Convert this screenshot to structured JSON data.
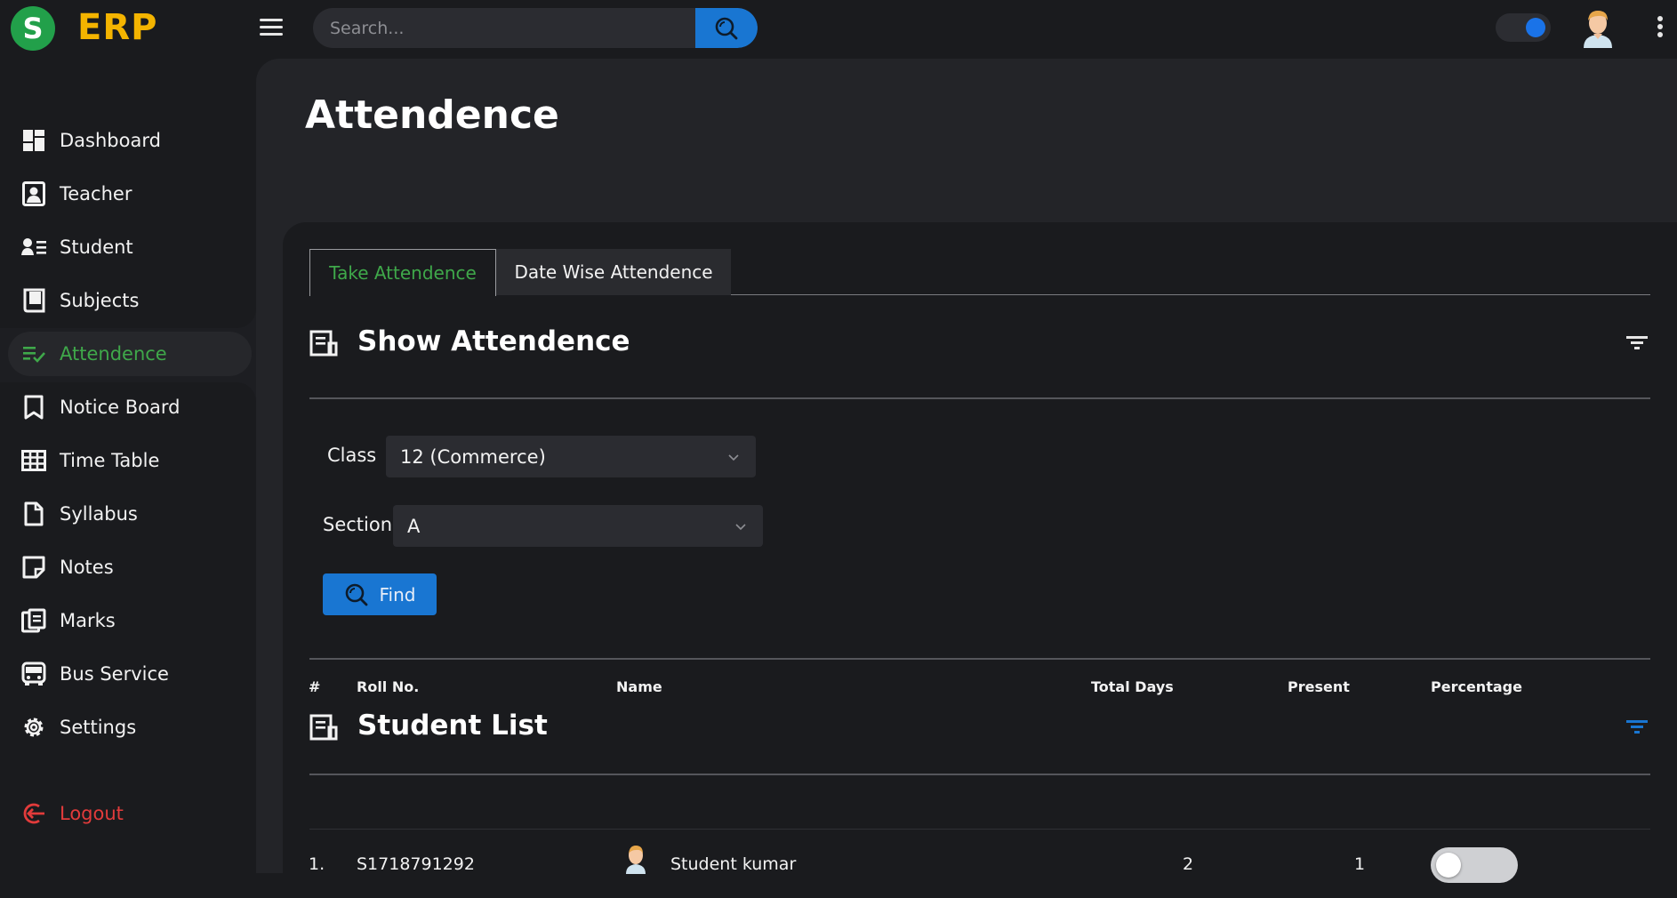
{
  "app": {
    "logo_letter": "S",
    "logo_text": "ERP"
  },
  "search": {
    "placeholder": "Search..."
  },
  "sidebar": {
    "items": [
      {
        "label": "Dashboard",
        "icon": "dashboard-icon"
      },
      {
        "label": "Teacher",
        "icon": "teacher-icon"
      },
      {
        "label": "Student",
        "icon": "student-icon"
      },
      {
        "label": "Subjects",
        "icon": "book-icon"
      },
      {
        "label": "Attendence",
        "icon": "checklist-icon",
        "active": true
      },
      {
        "label": "Notice Board",
        "icon": "bookmark-icon"
      },
      {
        "label": "Time Table",
        "icon": "table-grid-icon"
      },
      {
        "label": "Syllabus",
        "icon": "document-icon"
      },
      {
        "label": "Notes",
        "icon": "note-icon"
      },
      {
        "label": "Marks",
        "icon": "clipboard-icon"
      },
      {
        "label": "Bus Service",
        "icon": "bus-icon"
      },
      {
        "label": "Settings",
        "icon": "gear-icon"
      }
    ],
    "logout": "Logout"
  },
  "page": {
    "title": "Attendence"
  },
  "tabs": {
    "take": "Take Attendence",
    "date_wise": "Date Wise Attendence"
  },
  "show_section": {
    "title": "Show Attendence"
  },
  "form": {
    "class_label": "Class",
    "class_value": "12 (Commerce)",
    "section_label": "Section",
    "section_value": "A",
    "find_label": "Find"
  },
  "student_section": {
    "title": "Student List"
  },
  "table": {
    "headers": [
      "#",
      "Roll No.",
      "Name",
      "Total Days",
      "Present",
      "Percentage"
    ],
    "rows": [
      {
        "index": "1.",
        "roll": "S1718791292",
        "name": "Student kumar",
        "total_days": "2",
        "present": "1"
      }
    ]
  },
  "colors": {
    "accent_green": "#3fa84a",
    "accent_blue": "#1976d2",
    "logo_yellow": "#f4b400",
    "logout_red": "#e23b3b"
  }
}
